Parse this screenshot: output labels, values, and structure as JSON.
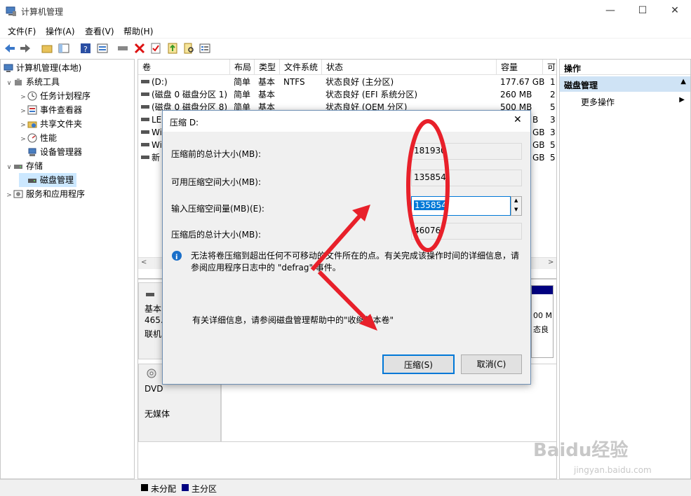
{
  "window": {
    "title": "计算机管理",
    "controls": [
      "—",
      "☐",
      "✕"
    ]
  },
  "menubar": [
    "文件(F)",
    "操作(A)",
    "查看(V)",
    "帮助(H)"
  ],
  "tree": [
    {
      "label": "计算机管理(本地)",
      "level": 0,
      "exp": ""
    },
    {
      "label": "系统工具",
      "level": 1,
      "exp": "∨"
    },
    {
      "label": "任务计划程序",
      "level": 2,
      "exp": ">"
    },
    {
      "label": "事件查看器",
      "level": 2,
      "exp": ">"
    },
    {
      "label": "共享文件夹",
      "level": 2,
      "exp": ">"
    },
    {
      "label": "性能",
      "level": 2,
      "exp": ">"
    },
    {
      "label": "设备管理器",
      "level": 2,
      "exp": ""
    },
    {
      "label": "存储",
      "level": 1,
      "exp": "∨"
    },
    {
      "label": "磁盘管理",
      "level": 2,
      "exp": "",
      "selected": true
    },
    {
      "label": "服务和应用程序",
      "level": 1,
      "exp": ">"
    }
  ],
  "volume_table": {
    "headers": [
      "卷",
      "布局",
      "类型",
      "文件系统",
      "状态",
      "容量",
      "可"
    ],
    "rows": [
      [
        "(D:)",
        "简单",
        "基本",
        "NTFS",
        "状态良好 (主分区)",
        "177.67 GB",
        "1"
      ],
      [
        "(磁盘 0 磁盘分区 1)",
        "简单",
        "基本",
        "",
        "状态良好 (EFI 系统分区)",
        "260 MB",
        "2"
      ],
      [
        "(磁盘 0 磁盘分区 8)",
        "简单",
        "基本",
        "",
        "状态良好 (OEM 分区)",
        "500 MB",
        "5"
      ],
      [
        "LE",
        "",
        "",
        "",
        "",
        "B",
        "3"
      ],
      [
        "Wi",
        "",
        "",
        "",
        "",
        "GB",
        "3"
      ],
      [
        "Wi",
        "",
        "",
        "",
        "",
        "GB",
        "5"
      ],
      [
        "新",
        "",
        "",
        "",
        "",
        "GB",
        "5"
      ]
    ]
  },
  "lower": {
    "disk0": [
      "基本",
      "465.",
      "联机"
    ],
    "disk0_right": [
      "00 M",
      "态良"
    ],
    "dvd": [
      "DVD",
      "无媒体"
    ]
  },
  "legend": [
    {
      "label": "未分配",
      "color": "#000000"
    },
    {
      "label": "主分区",
      "color": "#000080"
    }
  ],
  "actions": {
    "header": "操作",
    "section": "磁盘管理",
    "more": "更多操作"
  },
  "dialog": {
    "title": "压缩 D:",
    "close": "✕",
    "fields": [
      {
        "label": "压缩前的总计大小(MB):",
        "value": "181930"
      },
      {
        "label": "可用压缩空间大小(MB):",
        "value": "135854"
      },
      {
        "label": "输入压缩空间量(MB)(E):",
        "value": "135854"
      },
      {
        "label": "压缩后的总计大小(MB):",
        "value": "46076"
      }
    ],
    "info": "无法将卷压缩到超出任何不可移动的文件所在的点。有关完成该操作时间的详细信息，请参阅应用程序日志中的 \"defrag\" 事件。",
    "help": "有关详细信息，请参阅磁盘管理帮助中的\"收缩基本卷\"",
    "ok": "压缩(S)",
    "cancel": "取消(C)"
  },
  "watermark": "Baidu经验 jingyan.baidu.com"
}
